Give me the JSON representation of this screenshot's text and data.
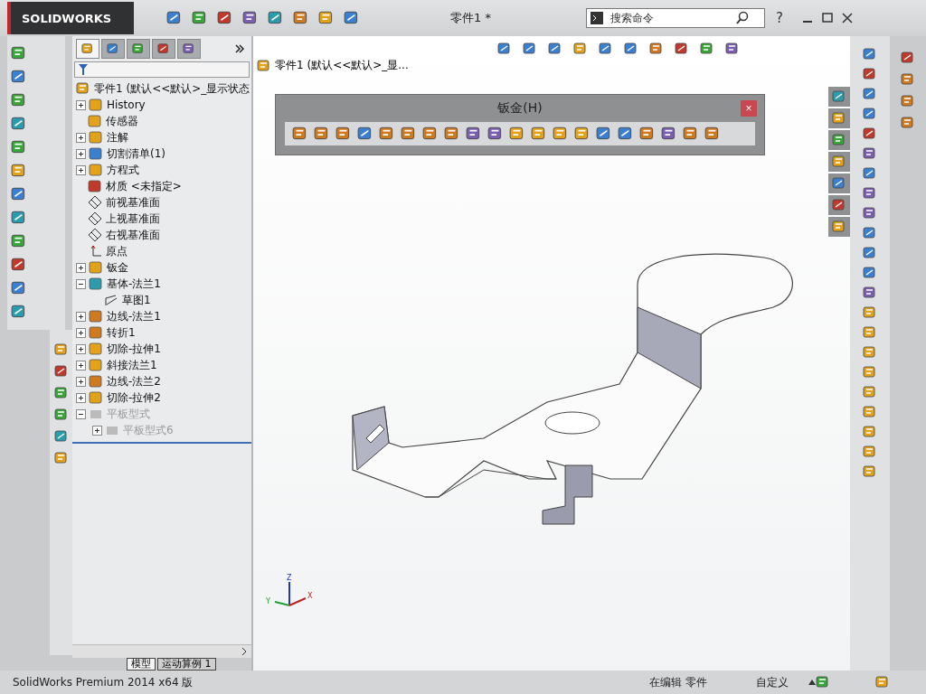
{
  "title_bar": {
    "logo": "SOLIDWORKS",
    "document_title": "零件1 *",
    "search": {
      "placeholder": "搜索命令"
    },
    "help": "?"
  },
  "feature_tree": {
    "panel_tabs": [
      {
        "selected": true
      },
      {
        "selected": false
      },
      {
        "selected": false
      },
      {
        "selected": false
      },
      {
        "selected": false
      }
    ],
    "root": "零件1  (默认<<默认>_显示状态",
    "items": [
      {
        "label": "History",
        "kind": "history",
        "expanded": false
      },
      {
        "label": "传感器",
        "kind": "sensor"
      },
      {
        "label": "注解",
        "kind": "annotation",
        "expanded": false
      },
      {
        "label": "切割清单(1)",
        "kind": "cutlist",
        "expanded": false
      },
      {
        "label": "方程式",
        "kind": "equation",
        "expanded": false
      },
      {
        "label": "材质 <未指定>",
        "kind": "material"
      },
      {
        "label": "前视基准面",
        "kind": "plane"
      },
      {
        "label": "上视基准面",
        "kind": "plane"
      },
      {
        "label": "右视基准面",
        "kind": "plane"
      },
      {
        "label": "原点",
        "kind": "origin"
      },
      {
        "label": "钣金",
        "kind": "sheetmetal",
        "expanded": false
      },
      {
        "label": "基体-法兰1",
        "kind": "flange",
        "expanded": true,
        "children": [
          {
            "label": "草图1",
            "kind": "sketch"
          }
        ]
      },
      {
        "label": "边线-法兰1",
        "kind": "edgeflange",
        "expanded": false
      },
      {
        "label": "转折1",
        "kind": "jog",
        "expanded": false
      },
      {
        "label": "切除-拉伸1",
        "kind": "cut",
        "expanded": false
      },
      {
        "label": "斜接法兰1",
        "kind": "miter",
        "expanded": false
      },
      {
        "label": "边线-法兰2",
        "kind": "edgeflange",
        "expanded": false
      },
      {
        "label": "切除-拉伸2",
        "kind": "cut",
        "expanded": false
      },
      {
        "label": "平板型式",
        "kind": "flat",
        "expanded": true,
        "disabled": true,
        "children": [
          {
            "label": "平板型式6",
            "kind": "flat",
            "expanded": false,
            "disabled": true
          }
        ]
      }
    ],
    "bottom_tabs": [
      {
        "label": "模型",
        "selected": true
      },
      {
        "label": "运动算例 1",
        "selected": false
      }
    ]
  },
  "viewport": {
    "breadcrumb": "零件1  (默认<<默认>_显...",
    "floating_toolbar": {
      "title": "钣金(H)",
      "close": "×"
    },
    "triad": {
      "x": "X",
      "y": "Y",
      "z": "Z"
    }
  },
  "status_bar": {
    "product": "SolidWorks Premium 2014 x64 版",
    "mode": "在编辑 零件",
    "units": "自定义"
  }
}
